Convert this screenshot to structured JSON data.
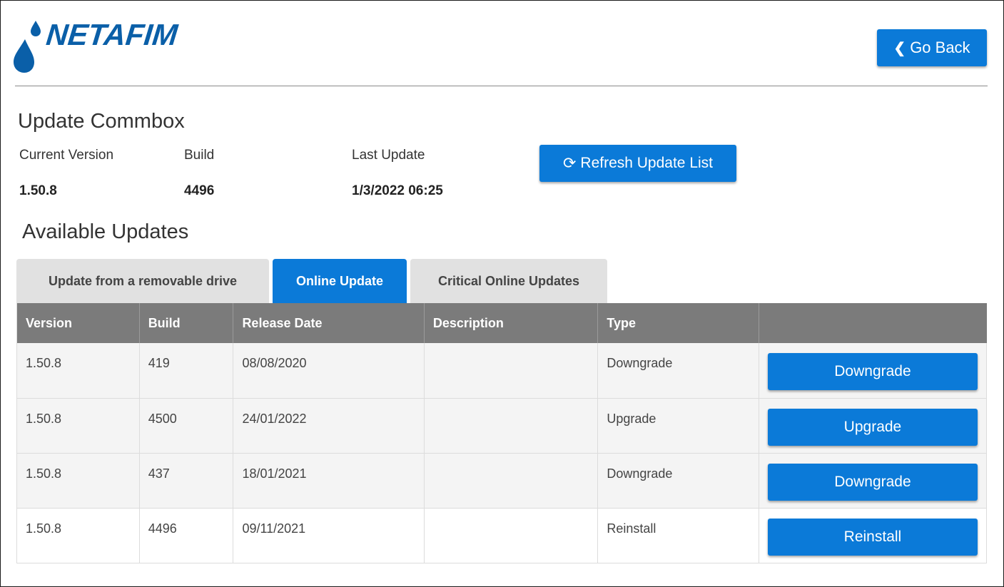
{
  "brand": {
    "logo_text": "NETAFIM",
    "logo_color": "#0a5fa8"
  },
  "header": {
    "go_back_label": "Go Back"
  },
  "page": {
    "title": "Update Commbox"
  },
  "info": {
    "current_version_label": "Current Version",
    "current_version_value": "1.50.8",
    "build_label": "Build",
    "build_value": "4496",
    "last_update_label": "Last Update",
    "last_update_value": "1/3/2022 06:25",
    "refresh_label": "Refresh Update List"
  },
  "updates": {
    "title": "Available Updates",
    "tabs": [
      {
        "label": "Update from a removable drive",
        "active": false
      },
      {
        "label": "Online Update",
        "active": true
      },
      {
        "label": "Critical Online Updates",
        "active": false
      }
    ],
    "columns": [
      "Version",
      "Build",
      "Release Date",
      "Description",
      "Type",
      ""
    ],
    "rows": [
      {
        "version": "1.50.8",
        "build": "419",
        "release_date": "08/08/2020",
        "description": "",
        "type": "Downgrade",
        "action": "Downgrade"
      },
      {
        "version": "1.50.8",
        "build": "4500",
        "release_date": "24/01/2022",
        "description": "",
        "type": "Upgrade",
        "action": "Upgrade"
      },
      {
        "version": "1.50.8",
        "build": "437",
        "release_date": "18/01/2021",
        "description": "",
        "type": "Downgrade",
        "action": "Downgrade"
      },
      {
        "version": "1.50.8",
        "build": "4496",
        "release_date": "09/11/2021",
        "description": "",
        "type": "Reinstall",
        "action": "Reinstall"
      }
    ]
  },
  "colors": {
    "accent": "#0b7ad8",
    "table_header": "#7b7b7b",
    "tab_inactive": "#e1e1e1"
  },
  "icons": {
    "back": "chevron-left-icon",
    "refresh": "refresh-icon",
    "logo": "water-drops-icon"
  }
}
